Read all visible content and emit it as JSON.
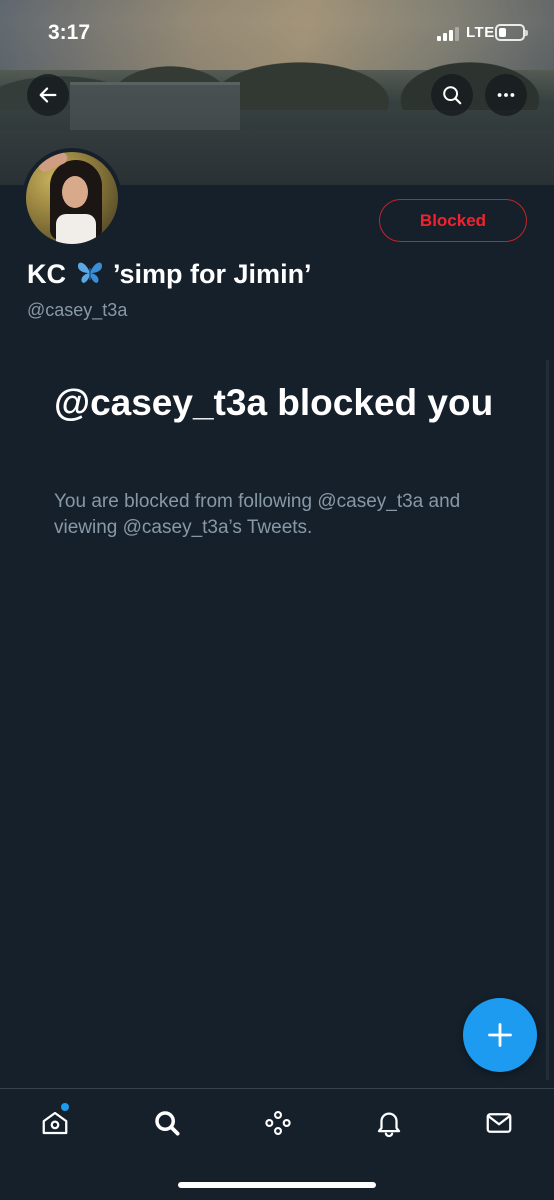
{
  "status_bar": {
    "time": "3:17",
    "network": "LTE",
    "signal_bars": 3,
    "signal_bars_max": 4,
    "battery_level": 0.3
  },
  "header": {
    "back_icon": "arrow-left-icon",
    "search_icon": "search-icon",
    "more_icon": "more-horizontal-icon"
  },
  "profile": {
    "name_prefix": "KC",
    "name_emoji": "butterfly-icon",
    "name_suffix": "’simp for Jimin’",
    "handle": "@casey_t3a",
    "follow_state_label": "Blocked"
  },
  "blocked_notice": {
    "title": "@casey_t3a blocked you",
    "description": "You are blocked from following @casey_t3a and viewing @casey_t3a’s Tweets."
  },
  "fab": {
    "icon": "plus-icon"
  },
  "tab_bar": {
    "items": [
      {
        "name": "home",
        "icon": "home-icon",
        "has_notification_dot": true
      },
      {
        "name": "search",
        "icon": "search-icon",
        "active": true
      },
      {
        "name": "spaces",
        "icon": "spaces-icon"
      },
      {
        "name": "notifications",
        "icon": "bell-icon"
      },
      {
        "name": "messages",
        "icon": "mail-icon"
      }
    ]
  },
  "colors": {
    "background": "#15202b",
    "accent": "#1d9bf0",
    "blocked_red": "#f4212e",
    "secondary_text": "#8899a6"
  }
}
